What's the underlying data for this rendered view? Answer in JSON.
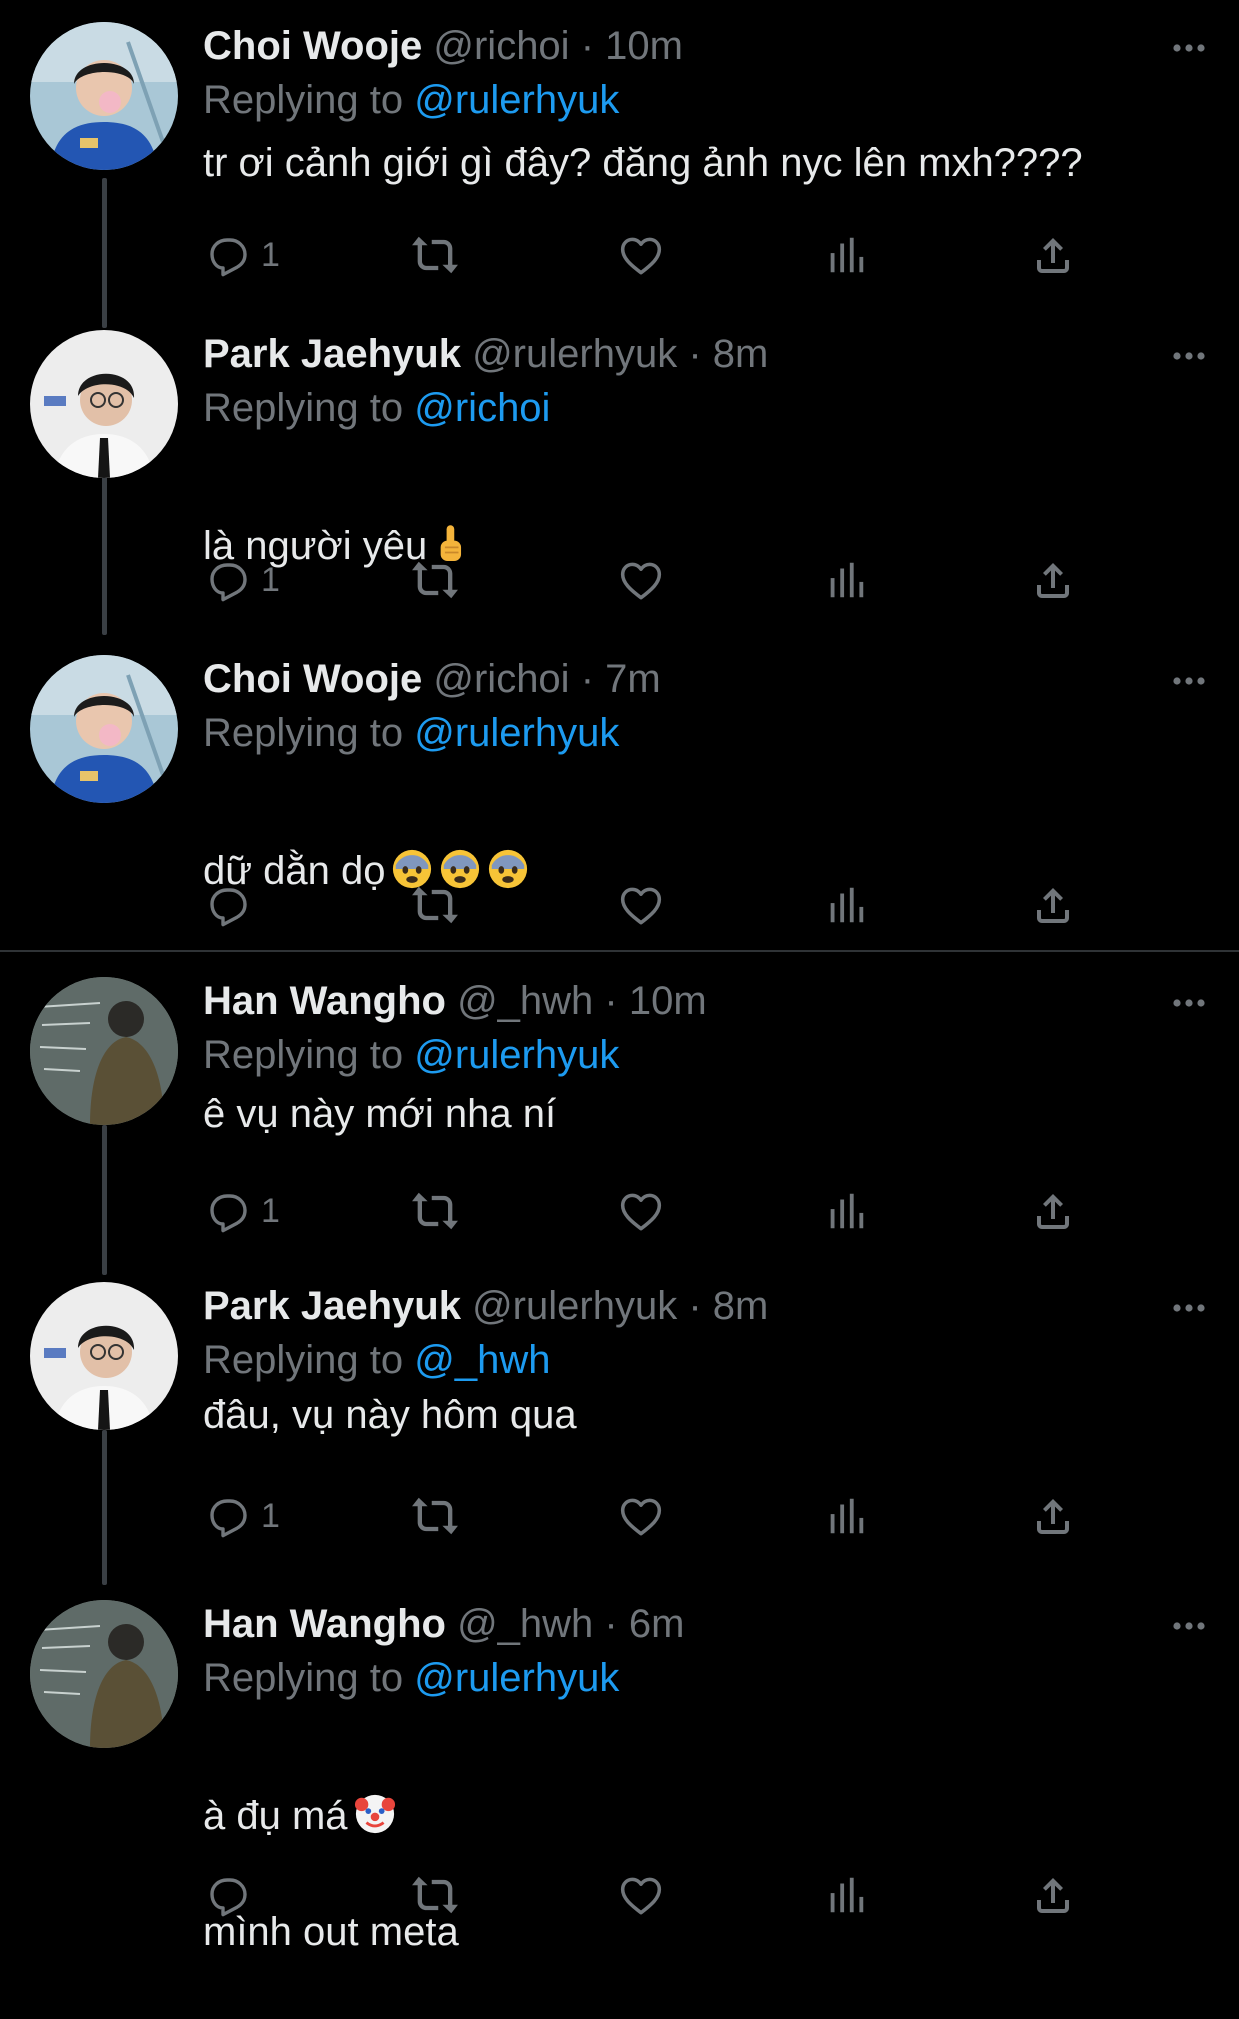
{
  "colors": {
    "background": "#000000",
    "text_primary": "#e7e9ea",
    "text_secondary": "#71767b",
    "mention": "#1d9bf0",
    "divider": "#2f3336"
  },
  "icons": {
    "reply": "speech-bubble-icon",
    "retweet": "retweet-arrows-icon",
    "like": "heart-outline-icon",
    "views": "bar-chart-icon",
    "share": "share-upload-icon",
    "more": "ellipsis-icon"
  },
  "threads": [
    {
      "tweets": [
        {
          "name": "Choi Wooje",
          "handle": "@richoi",
          "sep": "·",
          "time": "10m",
          "reply_prefix": "Replying to",
          "reply_to": "@rulerhyuk",
          "text": "tr ơi cảnh giới gì đây? đăng ảnh nyc lên mxh????",
          "reply_count": "1"
        },
        {
          "name": "Park Jaehyuk",
          "handle": "@rulerhyuk",
          "sep": "·",
          "time": "8m",
          "reply_prefix": "Replying to",
          "reply_to": "@richoi",
          "text": "là người yêu",
          "emoji": "pointing-up-finger",
          "reply_count": "1"
        },
        {
          "name": "Choi Wooje",
          "handle": "@richoi",
          "sep": "·",
          "time": "7m",
          "reply_prefix": "Replying to",
          "reply_to": "@rulerhyuk",
          "text": "dữ dằn dọ",
          "emoji": "fearful-face x3",
          "reply_count": ""
        }
      ]
    },
    {
      "tweets": [
        {
          "name": "Han Wangho",
          "handle": "@_hwh",
          "sep": "·",
          "time": "10m",
          "reply_prefix": "Replying to",
          "reply_to": "@rulerhyuk",
          "text": "ê vụ này mới nha ní",
          "reply_count": "1"
        },
        {
          "name": "Park Jaehyuk",
          "handle": "@rulerhyuk",
          "sep": "·",
          "time": "8m",
          "reply_prefix": "Replying to",
          "reply_to": "@_hwh",
          "text": "đâu, vụ này hôm qua",
          "reply_count": "1"
        },
        {
          "name": "Han Wangho",
          "handle": "@_hwh",
          "sep": "·",
          "time": "6m",
          "reply_prefix": "Replying to",
          "reply_to": "@rulerhyuk",
          "text_line1": "à đụ má",
          "emoji": "clown-face",
          "text_line2": "mình out meta",
          "reply_count": ""
        }
      ]
    }
  ]
}
